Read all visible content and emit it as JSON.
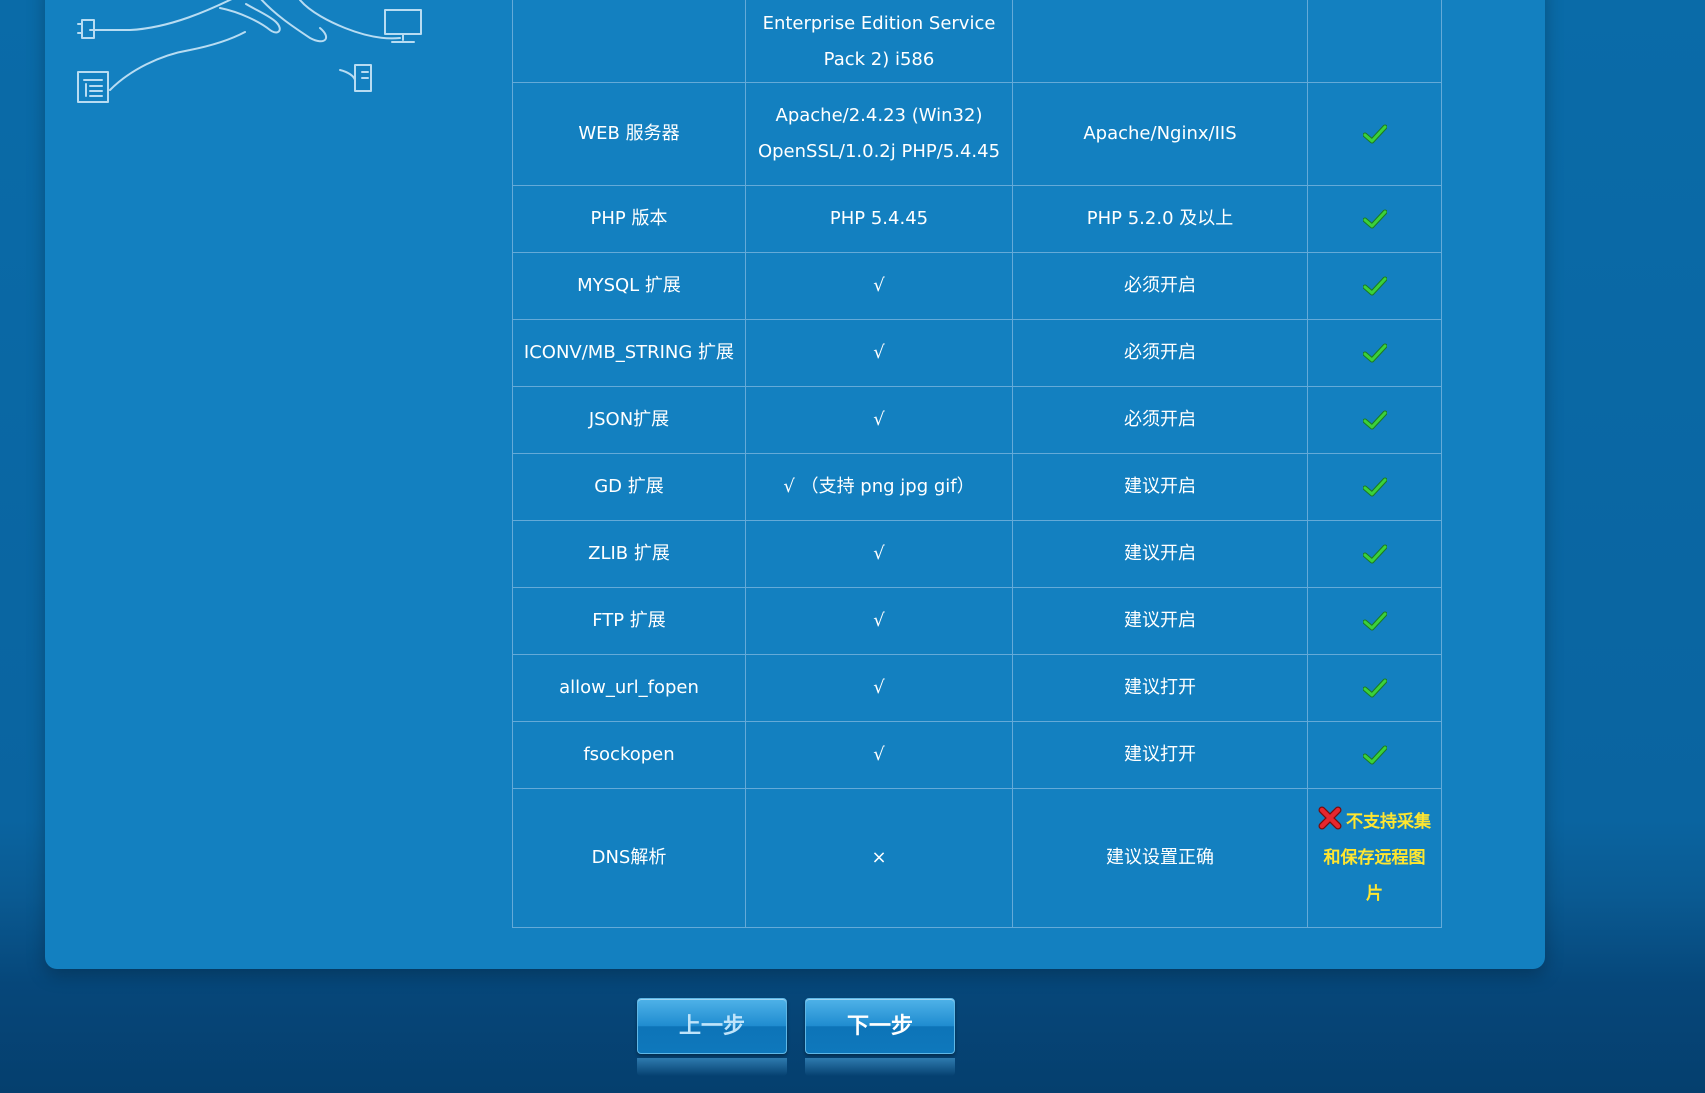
{
  "table": {
    "rows": [
      {
        "item": "",
        "current": "Enterprise Edition Service Pack 2) i586",
        "required": "",
        "status": "",
        "status_type": "none"
      },
      {
        "item": "WEB 服务器",
        "current": "Apache/2.4.23 (Win32) OpenSSL/1.0.2j PHP/5.4.45",
        "required": "Apache/Nginx/IIS",
        "status": "",
        "status_type": "ok"
      },
      {
        "item": "PHP 版本",
        "current": "PHP 5.4.45",
        "required": "PHP 5.2.0 及以上",
        "status": "",
        "status_type": "ok"
      },
      {
        "item": "MYSQL 扩展",
        "current": "√",
        "required": "必须开启",
        "status": "",
        "status_type": "ok"
      },
      {
        "item": "ICONV/MB_STRING 扩展",
        "current": "√",
        "required": "必须开启",
        "status": "",
        "status_type": "ok"
      },
      {
        "item": "JSON扩展",
        "current": "√",
        "required": "必须开启",
        "status": "",
        "status_type": "ok"
      },
      {
        "item": "GD 扩展",
        "current": "√ （支持 png jpg gif）",
        "required": "建议开启",
        "status": "",
        "status_type": "ok"
      },
      {
        "item": "ZLIB 扩展",
        "current": "√",
        "required": "建议开启",
        "status": "",
        "status_type": "ok"
      },
      {
        "item": "FTP 扩展",
        "current": "√",
        "required": "建议开启",
        "status": "",
        "status_type": "ok"
      },
      {
        "item": "allow_url_fopen",
        "current": "√",
        "required": "建议打开",
        "status": "",
        "status_type": "ok"
      },
      {
        "item": "fsockopen",
        "current": "√",
        "required": "建议打开",
        "status": "",
        "status_type": "ok"
      },
      {
        "item": "DNS解析",
        "current": "×",
        "required": "建议设置正确",
        "status": "不支持采集和保存远程图片",
        "status_type": "fail"
      }
    ]
  },
  "buttons": {
    "prev": "上一步",
    "next": "下一步"
  },
  "colors": {
    "ok": "#3bd13b",
    "fail": "#e8262e",
    "fail_text": "#ffe630",
    "panel": "#1380c0"
  },
  "icons": {
    "ok": "check-icon",
    "fail": "x-icon"
  }
}
